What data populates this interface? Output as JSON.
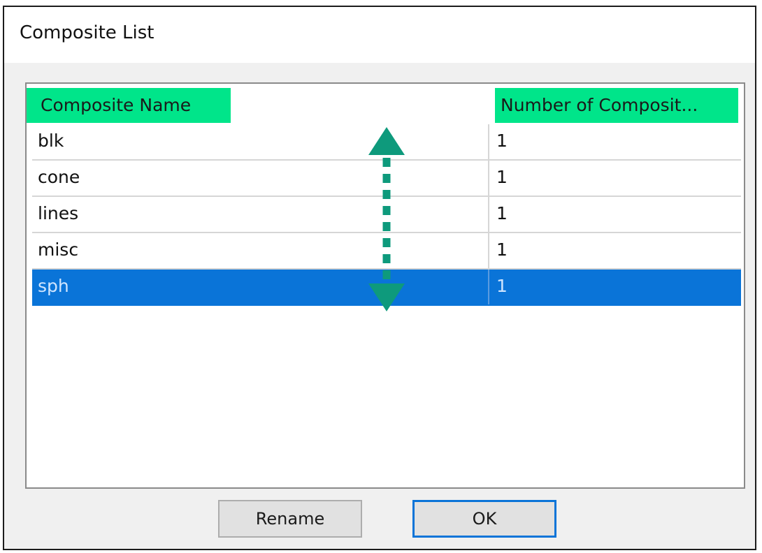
{
  "window": {
    "title": "Composite List"
  },
  "list": {
    "columns": [
      "Composite Name",
      "Number of Composit..."
    ],
    "rows": [
      {
        "name": "blk",
        "count": "1"
      },
      {
        "name": "cone",
        "count": "1"
      },
      {
        "name": "lines",
        "count": "1"
      },
      {
        "name": "misc",
        "count": "1"
      },
      {
        "name": "sph",
        "count": "1"
      }
    ],
    "selected_row": "sph",
    "header_highlight_color": "#00e58a",
    "selection_color": "#0a74d8"
  },
  "annotation": {
    "arrow_icon": "double-headed-vertical-arrow-icon",
    "arrow_color": "#0e9a7c"
  },
  "buttons": {
    "rename_label": "Rename",
    "ok_label": "OK"
  }
}
